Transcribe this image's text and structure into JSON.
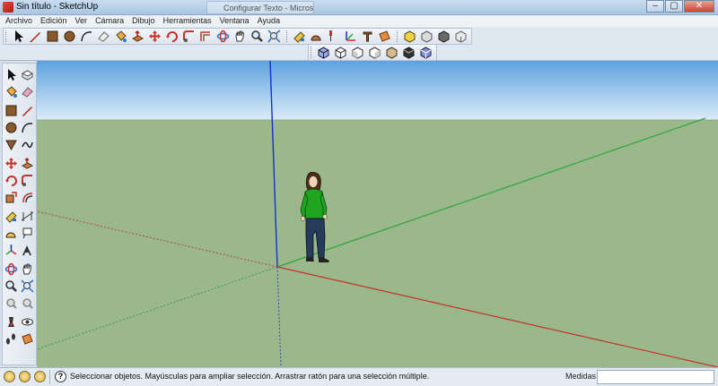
{
  "window": {
    "title": "Sin título - SketchUp",
    "background_tab": "Configurar Texto - Micros...",
    "controls": [
      "–",
      "▢",
      "✕"
    ]
  },
  "menu": {
    "items": [
      "Archivo",
      "Edición",
      "Ver",
      "Cámara",
      "Dibujo",
      "Herramientas",
      "Ventana",
      "Ayuda"
    ]
  },
  "toolbar_main": {
    "tools": [
      "select-arrow",
      "pencil-line",
      "rectangle",
      "circle",
      "arc",
      "eraser",
      "paint-bucket",
      "push-pull",
      "move",
      "rotate",
      "follow-me",
      "offset",
      "orbit",
      "pan",
      "zoom",
      "zoom-extents",
      "tape-measure",
      "protractor",
      "text",
      "axes",
      "3d-text",
      "section-plane"
    ]
  },
  "toolbar_views": {
    "tools": [
      "iso-view",
      "top-view",
      "front-view",
      "right-view",
      "back-view",
      "left-view",
      "shaded-texture"
    ]
  },
  "left_toolbar": {
    "tools": [
      "select",
      "component",
      "paint",
      "eraser",
      "rectangle",
      "line",
      "circle",
      "arc",
      "polygon",
      "freehand",
      "move",
      "push-pull",
      "rotate",
      "follow-me",
      "scale",
      "offset",
      "tape",
      "dimension",
      "protractor",
      "text",
      "axes",
      "3d-text",
      "orbit",
      "pan",
      "zoom",
      "zoom-window",
      "previous",
      "next",
      "position-camera",
      "look-around",
      "walk",
      "section"
    ]
  },
  "colors": {
    "sky_top": "#5da2df",
    "ground": "#9ab88c",
    "axis_red": "#c8302b",
    "axis_green": "#2fa53a",
    "axis_blue": "#1a2fd0"
  },
  "status": {
    "message": "Seleccionar objetos. Mayúsculas para ampliar selección. Arrastrar ratón para una selección múltiple.",
    "measure_label": "Medidas",
    "measure_value": ""
  }
}
